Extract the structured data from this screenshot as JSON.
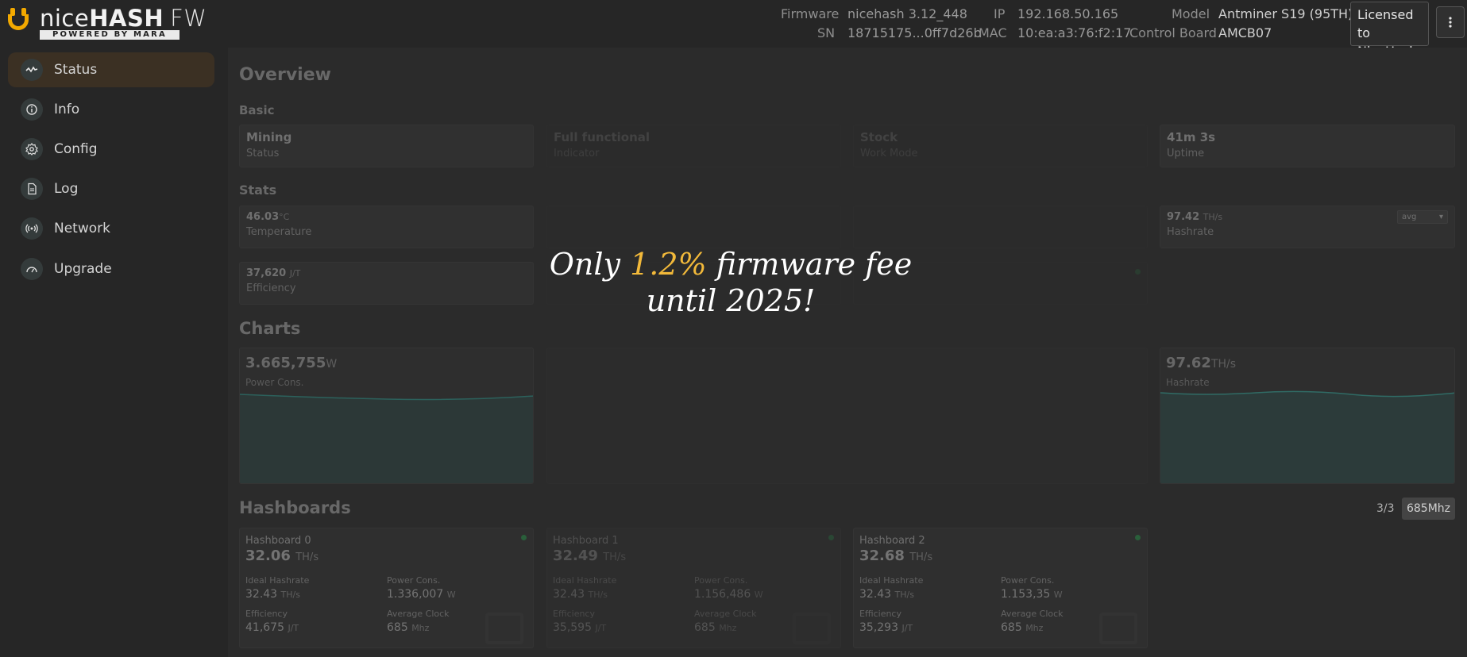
{
  "logo": {
    "name_light": "nice",
    "name_bold": "HASH",
    "name_suffix": "FW",
    "tagline": "POWERED BY MARA",
    "brand_color": "#f2a900"
  },
  "header": {
    "firmware_label": "Firmware",
    "firmware_value": "nicehash 3.12_448",
    "sn_label": "SN",
    "sn_value": "18715175...0ff7d26b",
    "ip_label": "IP",
    "ip_value": "192.168.50.165",
    "mac_label": "MAC",
    "mac_value": "10:ea:a3:76:f2:17",
    "model_label": "Model",
    "model_value": "Antminer S19 (95TH)",
    "board_label": "Control Board",
    "board_value": "AMCB07",
    "license_line1": "Licensed to",
    "license_line2": "NiceHash",
    "menu_icon": "more-vertical-icon"
  },
  "sidebar": {
    "items": [
      {
        "label": "Status",
        "icon": "activity-icon",
        "active": true
      },
      {
        "label": "Info",
        "icon": "info-icon"
      },
      {
        "label": "Config",
        "icon": "gear-icon"
      },
      {
        "label": "Log",
        "icon": "document-icon"
      },
      {
        "label": "Network",
        "icon": "broadcast-icon"
      },
      {
        "label": "Upgrade",
        "icon": "gauge-icon"
      }
    ]
  },
  "overview": {
    "title": "Overview",
    "basic_title": "Basic",
    "basic": [
      {
        "value": "Mining",
        "label": "Status"
      },
      {
        "value": "Full functional",
        "label": "Indicator"
      },
      {
        "value": "Stock",
        "label": "Work Mode"
      },
      {
        "value": "41m 3s",
        "label": "Uptime"
      }
    ],
    "stats_title": "Stats",
    "stats": {
      "temperature": {
        "value": "46.03",
        "unit": "°C",
        "label": "Temperature"
      },
      "hashrate": {
        "value": "97.42",
        "unit": "TH/s",
        "label": "Hashrate",
        "select": "avg"
      },
      "efficiency": {
        "value": "37,620",
        "unit": "J/T",
        "label": "Efficiency"
      }
    }
  },
  "charts": {
    "title": "Charts",
    "power": {
      "value": "3.665,755",
      "unit": "W",
      "label": "Power Cons."
    },
    "hashrate": {
      "value": "97.62",
      "unit": "TH/s",
      "label": "Hashrate"
    },
    "line_color": "#2f8f85"
  },
  "hashboards": {
    "title": "Hashboards",
    "count": "3/3",
    "clock": "685Mhz",
    "labels": {
      "ideal": "Ideal Hashrate",
      "power": "Power Cons.",
      "efficiency": "Efficiency",
      "clock": "Average Clock"
    },
    "units": {
      "rate": "TH/s",
      "power": "W",
      "eff": "J/T",
      "clock": "Mhz"
    },
    "boards": [
      {
        "name": "Hashboard 0",
        "rate": "32.06",
        "ideal": "32.43",
        "power": "1.336,007",
        "efficiency": "41,675",
        "clock": "685"
      },
      {
        "name": "Hashboard 1",
        "rate": "32.49",
        "ideal": "32.43",
        "power": "1.156,486",
        "efficiency": "35,595",
        "clock": "685"
      },
      {
        "name": "Hashboard 2",
        "rate": "32.68",
        "ideal": "32.43",
        "power": "1.153,35",
        "efficiency": "35,293",
        "clock": "685"
      }
    ]
  },
  "banner": {
    "prefix": "Only ",
    "highlight": "1.2%",
    "suffix": " firmware fee",
    "line2": "until 2025!",
    "highlight_color": "#f2b93a"
  }
}
